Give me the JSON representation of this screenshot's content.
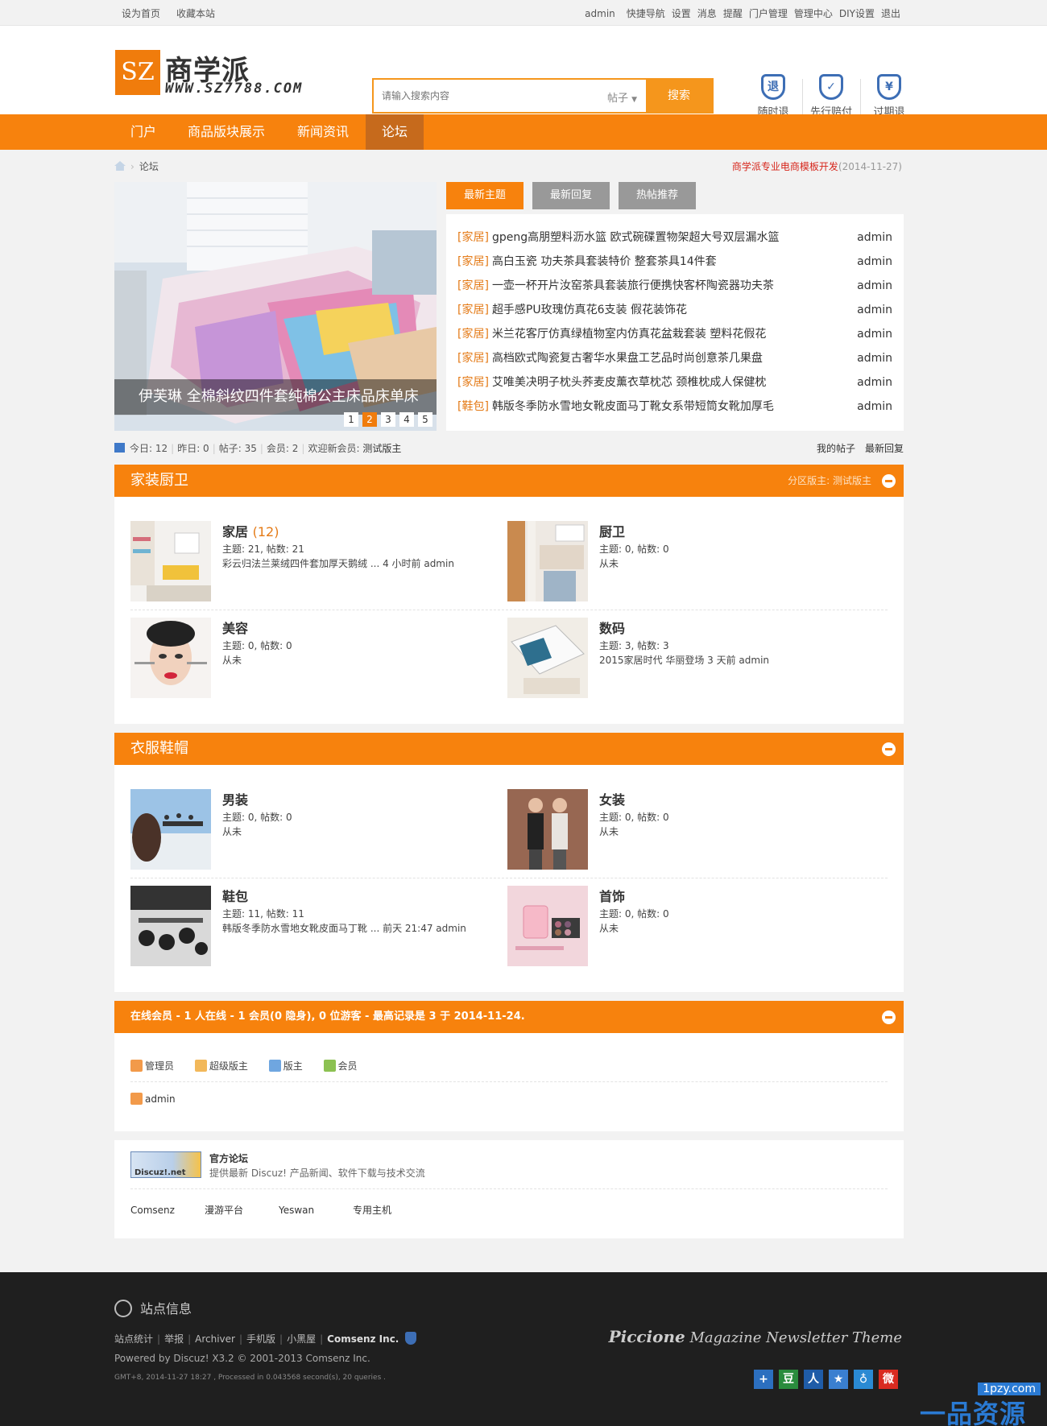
{
  "topbar": {
    "left": [
      "设为首页",
      "收藏本站"
    ],
    "right": [
      "admin",
      "快捷导航",
      "设置",
      "消息",
      "提醒",
      "门户管理",
      "管理中心",
      "DIY设置",
      "退出"
    ]
  },
  "logo": {
    "mark": "SZ",
    "name": "商学派",
    "domain": "WWW.SZ7788.COM"
  },
  "search": {
    "placeholder": "请输入搜索内容",
    "type": "帖子",
    "button": "搜索"
  },
  "badges": [
    {
      "label": "随时退",
      "icon": "return-shield-icon",
      "glyph": "退"
    },
    {
      "label": "先行赔付",
      "icon": "check-shield-icon",
      "glyph": "✓"
    },
    {
      "label": "过期退",
      "icon": "yen-shield-icon",
      "glyph": "¥"
    }
  ],
  "nav": [
    "门户",
    "商品版块展示",
    "新闻资讯",
    "论坛"
  ],
  "breadcrumb": {
    "current": "论坛"
  },
  "notice": {
    "title": "商学派专业电商模板开发",
    "date": "(2014-11-27)"
  },
  "slider": {
    "caption": "伊芙琳 全棉斜纹四件套纯棉公主床品床单床",
    "pages": [
      "1",
      "2",
      "3",
      "4",
      "5"
    ],
    "active_page": "2"
  },
  "tabs": [
    "最新主题",
    "最新回复",
    "热帖推荐"
  ],
  "threads": [
    {
      "cat": "[家居]",
      "title": "gpeng高朋塑料沥水篮 欧式碗碟置物架超大号双层漏水篮",
      "author": "admin"
    },
    {
      "cat": "[家居]",
      "title": "高白玉瓷 功夫茶具套装特价 整套茶具14件套",
      "author": "admin"
    },
    {
      "cat": "[家居]",
      "title": "一壶一杯开片汝窑茶具套装旅行便携快客杯陶瓷器功夫茶",
      "author": "admin"
    },
    {
      "cat": "[家居]",
      "title": "超手感PU玫瑰仿真花6支装 假花装饰花",
      "author": "admin"
    },
    {
      "cat": "[家居]",
      "title": "米兰花客厅仿真绿植物室内仿真花盆栽套装 塑料花假花",
      "author": "admin"
    },
    {
      "cat": "[家居]",
      "title": "高档欧式陶瓷复古奢华水果盘工艺品时尚创意茶几果盘",
      "author": "admin"
    },
    {
      "cat": "[家居]",
      "title": "艾唯美决明子枕头荞麦皮薰衣草枕芯 颈椎枕成人保健枕",
      "author": "admin"
    },
    {
      "cat": "[鞋包]",
      "title": "韩版冬季防水雪地女靴皮面马丁靴女系带短筒女靴加厚毛",
      "author": "admin"
    }
  ],
  "stats": {
    "items": [
      "今日: 12",
      "昨日: 0",
      "帖子: 35",
      "会员: 2"
    ],
    "welcome": "欢迎新会员:",
    "new_member": "测试版主",
    "my_posts": "我的帖子",
    "latest_replies": "最新回复"
  },
  "sections": [
    {
      "title": "家装厨卫",
      "moderator": "分区版主: 测试版主",
      "forums": [
        {
          "name": "家居",
          "count": "(12)",
          "meta": "主题: 21, 帖数: 21",
          "last": "彩云归法兰莱绒四件套加厚天鹅绒 ... 4 小时前 admin"
        },
        {
          "name": "厨卫",
          "count": "",
          "meta": "主题: 0, 帖数: 0",
          "last": "从未"
        },
        {
          "name": "美容",
          "count": "",
          "meta": "主题: 0, 帖数: 0",
          "last": "从未"
        },
        {
          "name": "数码",
          "count": "",
          "meta": "主题: 3, 帖数: 3",
          "last": "2015家居时代 华丽登场 3 天前 admin"
        }
      ]
    },
    {
      "title": "衣服鞋帽",
      "moderator": "",
      "forums": [
        {
          "name": "男装",
          "count": "",
          "meta": "主题: 0, 帖数: 0",
          "last": "从未"
        },
        {
          "name": "女装",
          "count": "",
          "meta": "主题: 0, 帖数: 0",
          "last": "从未"
        },
        {
          "name": "鞋包",
          "count": "",
          "meta": "主题: 11, 帖数: 11",
          "last": "韩版冬季防水雪地女靴皮面马丁靴 ... 前天 21:47 admin"
        },
        {
          "name": "首饰",
          "count": "",
          "meta": "主题: 0, 帖数: 0",
          "last": "从未"
        }
      ]
    }
  ],
  "online": {
    "title": "在线会员 - 1 人在线 - 1 会员(0 隐身), 0 位游客 - 最高记录是 3 于 2014-11-24.",
    "legend": [
      {
        "label": "管理员",
        "color": "#f29a4a"
      },
      {
        "label": "超级版主",
        "color": "#f2b85a"
      },
      {
        "label": "版主",
        "color": "#6fa6e0"
      },
      {
        "label": "会员",
        "color": "#8cc152"
      }
    ],
    "user": "admin"
  },
  "links": {
    "logo_text": "Discuz!.net",
    "title": "官方论坛",
    "desc": "提供最新 Discuz! 产品新闻、软件下载与技术交流",
    "items": [
      "Comsenz",
      "漫游平台",
      "Yeswan",
      "专用主机"
    ]
  },
  "footer": {
    "site_info": "站点信息",
    "links": [
      "站点统计",
      "举报",
      "Archiver",
      "手机版",
      "小黑屋"
    ],
    "company": "Comsenz Inc.",
    "powered": "Powered by Discuz! X3.2 © 2001-2013 Comsenz Inc.",
    "gmt": "GMT+8, 2014-11-27 18:27 , Processed in 0.043568 second(s), 20 queries .",
    "theme_brand": "Piccione",
    "theme_rest": "Magazine Newsletter Theme",
    "social": [
      {
        "glyph": "+",
        "color": "#2c6fbf"
      },
      {
        "glyph": "豆",
        "color": "#2a8c3d"
      },
      {
        "glyph": "人",
        "color": "#1f5ca8"
      },
      {
        "glyph": "★",
        "color": "#3a7fd0"
      },
      {
        "glyph": "♁",
        "color": "#2a8ad3"
      },
      {
        "glyph": "微",
        "color": "#d92b20"
      }
    ]
  },
  "watermark": {
    "url": "1pzy.com",
    "text": "一品资源网"
  }
}
